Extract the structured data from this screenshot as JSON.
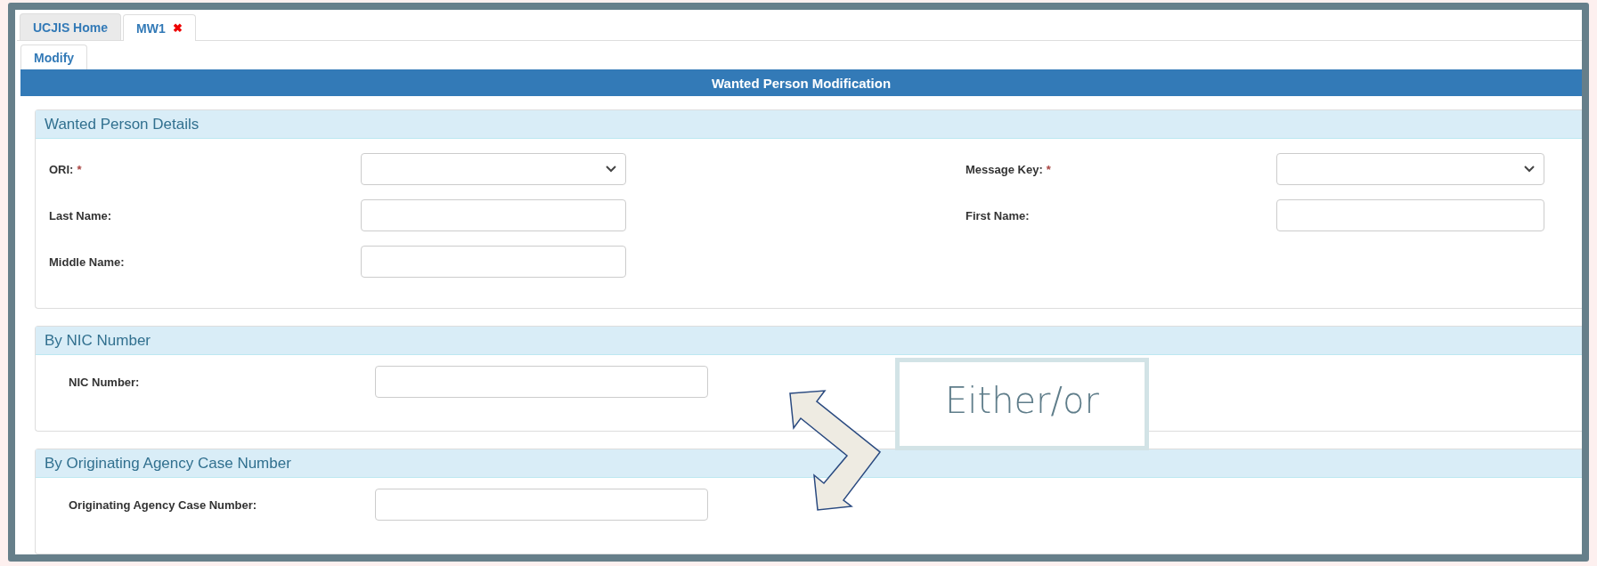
{
  "tabs": [
    {
      "label": "UCJIS Home",
      "selected": false
    },
    {
      "label": "MW1",
      "selected": true,
      "close_glyph": "✖"
    }
  ],
  "subtabs": [
    {
      "label": "Modify",
      "selected": true
    }
  ],
  "title": "Wanted Person Modification",
  "sections": [
    {
      "title": "Wanted Person Details",
      "kind": "two-column",
      "fields": [
        {
          "label": "ORI:",
          "required_mark": "*",
          "kind": "select"
        },
        {
          "label": "Message Key:",
          "required_mark": "*",
          "kind": "select"
        },
        {
          "label": "Last Name:",
          "kind": "text"
        },
        {
          "label": "First Name:",
          "kind": "text"
        },
        {
          "label": "Middle Name:",
          "kind": "text"
        }
      ]
    },
    {
      "title": "By NIC Number",
      "kind": "single",
      "fields": [
        {
          "label": "NIC Number:",
          "kind": "text"
        }
      ]
    },
    {
      "title": "By Originating Agency Case Number",
      "kind": "single",
      "fields": [
        {
          "label": "Originating Agency Case Number:",
          "kind": "text"
        }
      ]
    }
  ],
  "callout": {
    "text": "Either/or"
  }
}
